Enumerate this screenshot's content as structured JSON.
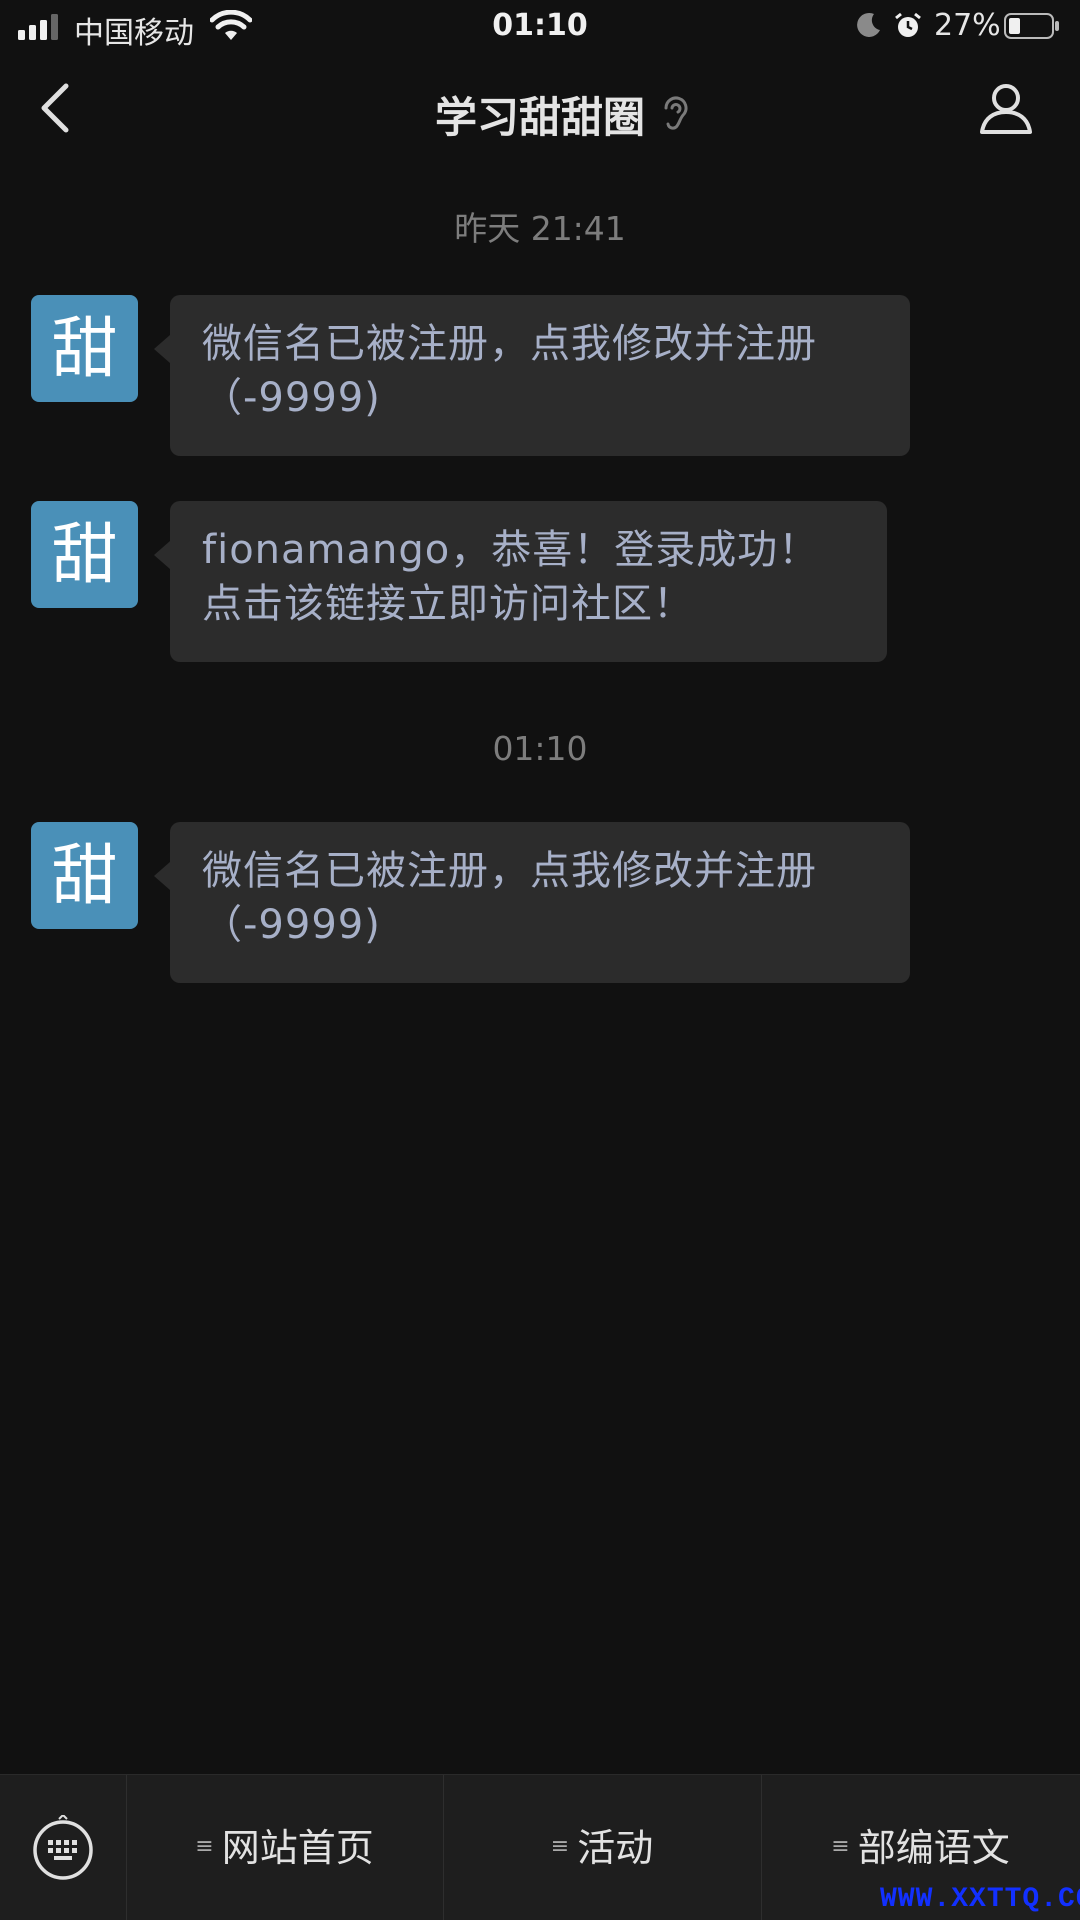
{
  "status_bar": {
    "carrier": "中国移动",
    "time": "01:10",
    "battery": "27%"
  },
  "nav": {
    "title": "学习甜甜圈"
  },
  "chat": {
    "timestamps": [
      "昨天 21:41",
      "01:10"
    ],
    "avatar_glyph": "甜",
    "messages": [
      {
        "line1": "微信名已被注册，点我修改并注册",
        "line2": "（-9999)"
      },
      {
        "line1": "fionamango，恭喜！登录成功！",
        "line2": "点击该链接立即访问社区！"
      },
      {
        "line1": "微信名已被注册，点我修改并注册",
        "line2": "（-9999)"
      }
    ]
  },
  "bottom_menu": {
    "items": [
      "网站首页",
      "活动",
      "部编语文"
    ]
  },
  "watermark": "WWW.XXTTQ.COM",
  "colors": {
    "background": "#111111",
    "bubble": "#2c2c2c",
    "avatar": "#4a90b8",
    "watermark": "#1230ff"
  }
}
